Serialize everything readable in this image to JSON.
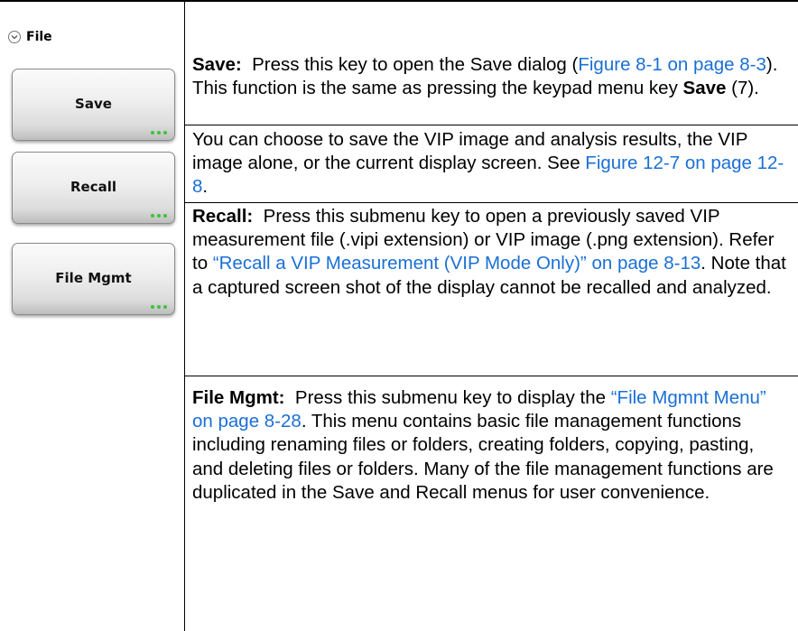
{
  "menu": {
    "title": "File",
    "buttons": [
      {
        "label": "Save"
      },
      {
        "label": "Recall"
      },
      {
        "label": "File Mgmt"
      }
    ],
    "accent_color": "#3bc43b"
  },
  "entries": {
    "save": {
      "term": "Save:",
      "text1": "Press this key to open the Save dialog (",
      "link1": "Figure 8-1 on page 8-3",
      "text2": "). This function is the same as pressing the keypad menu key ",
      "key": "Save",
      "text3": " (7)."
    },
    "save_note": {
      "text1": "You can choose to save the VIP image and analysis results, the VIP image alone, or the current display screen. See ",
      "link1": "Figure 12-7 on page 12-8",
      "text2": "."
    },
    "recall": {
      "term": "Recall:",
      "text1": "Press this submenu key to open a previously saved VIP measurement file (.vipi extension) or VIP image (.png extension). Refer to ",
      "link1": "“Recall a VIP Measurement (VIP Mode Only)” on page 8-13",
      "text2": ". Note that a captured screen shot of the display cannot be recalled and analyzed."
    },
    "file_mgmt": {
      "term": "File Mgmt:",
      "text1": "Press this submenu key to display the ",
      "link1": "“File Mgmnt Menu” on page 8-28",
      "text2": ". This menu contains basic file management functions including renaming files or folders, creating folders, copying, pasting, and deleting files or folders. Many of the file management functions are duplicated in the Save and Recall menus for user convenience."
    }
  },
  "colors": {
    "link": "#1a6fd6"
  }
}
